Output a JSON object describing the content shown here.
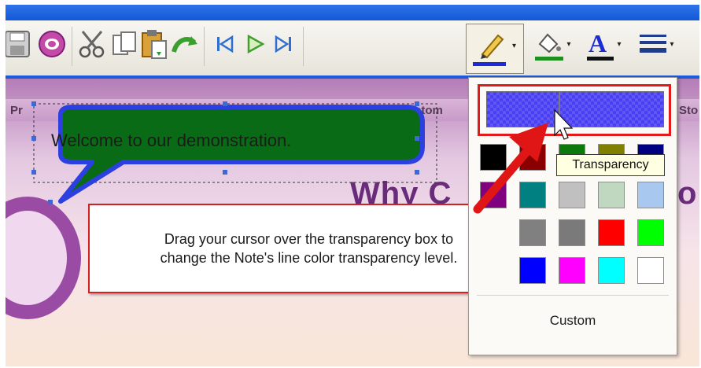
{
  "toolbar": {
    "buttons": [
      {
        "icon": "save-icon"
      },
      {
        "icon": "note-icon"
      },
      {
        "icon": "cut-icon"
      },
      {
        "icon": "copy-icon"
      },
      {
        "icon": "paste-icon"
      },
      {
        "icon": "undo-icon"
      },
      {
        "icon": "first-icon"
      },
      {
        "icon": "play-icon"
      },
      {
        "icon": "last-icon"
      },
      {
        "icon": "line-color-icon"
      },
      {
        "icon": "fill-color-icon"
      },
      {
        "icon": "font-color-icon"
      },
      {
        "icon": "line-style-icon"
      }
    ]
  },
  "slide": {
    "nav_left": "Pr",
    "nav_mid": "Custom",
    "nav_right": "Sto",
    "heading": "Why C",
    "heading_right": "o"
  },
  "callout": {
    "text": "Welcome to our demonstration."
  },
  "info": {
    "line1": "Drag your cursor over the transparency box to",
    "line2": "change the Note's line color transparency level."
  },
  "popup": {
    "transparency_tooltip": "Transparency",
    "custom_label": "Custom",
    "swatches": [
      "#000000",
      "#8a0000",
      "#0b7a0b",
      "#808000",
      "#000080",
      "#800080",
      "#008080",
      "#c0c0c0",
      "#c0d8c0",
      "#a8c8f0",
      "#808080",
      "#7a7a7a",
      "#ff0000",
      "#00ff00",
      "#0000ff",
      "#ff00ff",
      "#00ffff",
      "#ffffff"
    ]
  },
  "colors": {
    "accent_blue": "#1b5ad8",
    "transparency_fill": "#4a40f3",
    "highlight_red": "#e21a1a",
    "callout_green": "#0a6b16",
    "callout_border": "#2c3fe0"
  }
}
